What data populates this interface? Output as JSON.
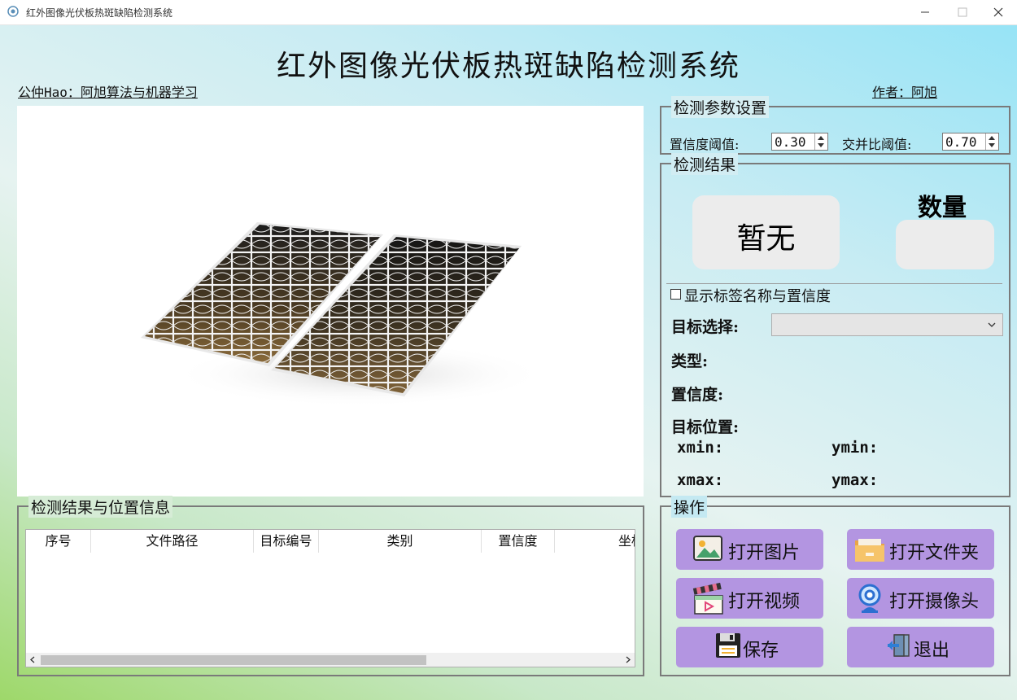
{
  "window": {
    "title": "红外图像光伏板热斑缺陷检测系统"
  },
  "header": {
    "title": "红外图像光伏板热斑缺陷检测系统",
    "left_link": "公仲Hao：阿旭算法与机器学习",
    "right_link": "作者：阿旭"
  },
  "params": {
    "title": "检测参数设置",
    "conf_label": "置信度阈值:",
    "conf_value": "0.30",
    "iou_label": "交并比阈值:",
    "iou_value": "0.70"
  },
  "result": {
    "title": "检测结果",
    "status": "暂无",
    "count_label": "数量",
    "count_value": "",
    "show_label_checkbox": "显示标签名称与置信度",
    "target_select_label": "目标选择:",
    "target_select_value": "",
    "type_label": "类型:",
    "confidence_label": "置信度:",
    "position_label": "目标位置:",
    "xmin_label": "xmin:",
    "ymin_label": "ymin:",
    "xmax_label": "xmax:",
    "ymax_label": "ymax:"
  },
  "table": {
    "title": "检测结果与位置信息",
    "columns": [
      "序号",
      "文件路径",
      "目标编号",
      "类别",
      "置信度",
      "坐标位置"
    ],
    "rows": []
  },
  "operations": {
    "title": "操作",
    "buttons": {
      "open_image": "打开图片",
      "open_folder": "打开文件夹",
      "open_video": "打开视频",
      "open_camera": "打开摄像头",
      "save": "保存",
      "exit": "退出"
    }
  },
  "colors": {
    "button_bg": "#b395e1",
    "result_box_bg": "#ececec",
    "panel_border": "#7a7a7a"
  }
}
